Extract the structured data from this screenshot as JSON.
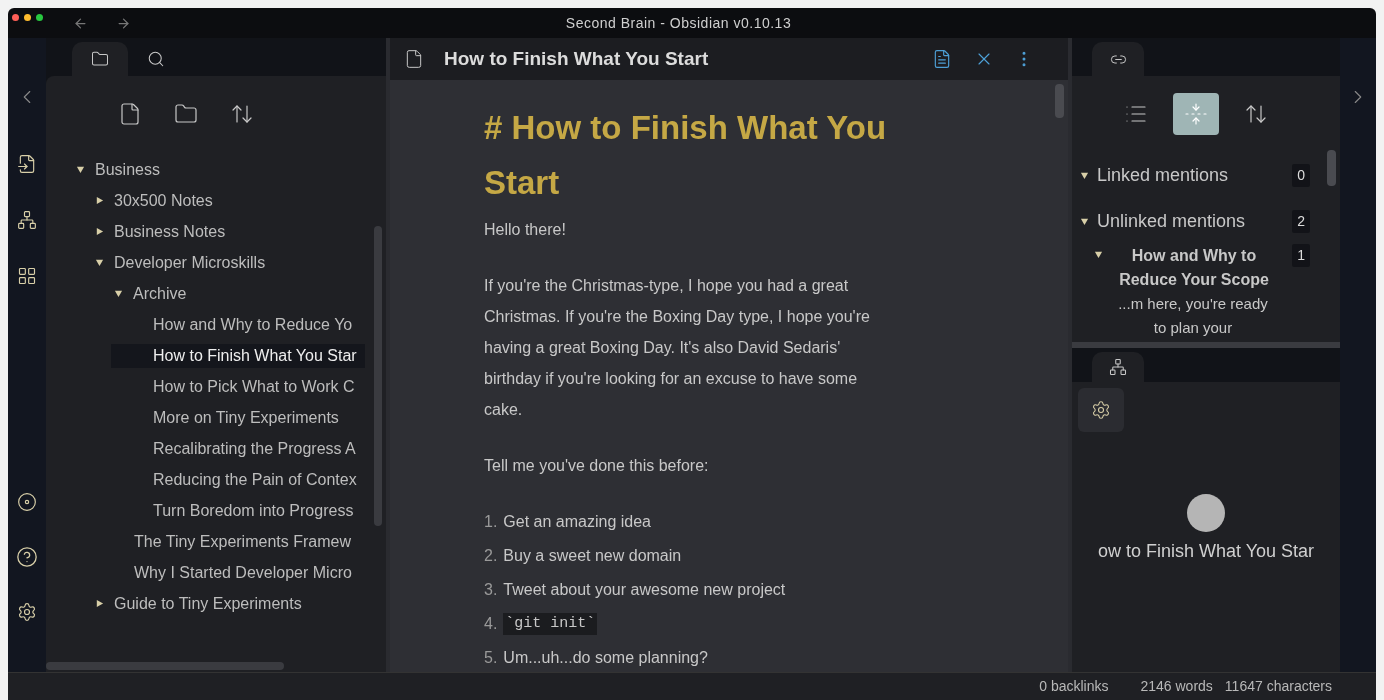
{
  "window": {
    "title": "Second Brain - Obsidian v0.10.13"
  },
  "left_panel": {
    "tabs": [
      {
        "selected": true
      },
      {
        "selected": false
      }
    ],
    "tree": [
      {
        "kind": "folder",
        "label": "Business",
        "expanded": true,
        "selected": false,
        "children": [
          {
            "kind": "folder",
            "label": "30x500 Notes",
            "expanded": false,
            "selected": false
          },
          {
            "kind": "folder",
            "label": "Business Notes",
            "expanded": false,
            "selected": false
          },
          {
            "kind": "folder",
            "label": "Developer Microskills",
            "expanded": true,
            "selected": false,
            "children": [
              {
                "kind": "folder",
                "label": "Archive",
                "expanded": true,
                "selected": false,
                "children": [
                  {
                    "kind": "file",
                    "label": "How and Why to Reduce Yo",
                    "selected": false
                  },
                  {
                    "kind": "file",
                    "label": "How to Finish What You Star",
                    "selected": true
                  },
                  {
                    "kind": "file",
                    "label": "How to Pick What to Work C",
                    "selected": false
                  },
                  {
                    "kind": "file",
                    "label": "More on Tiny Experiments",
                    "selected": false
                  },
                  {
                    "kind": "file",
                    "label": "Recalibrating the Progress A",
                    "selected": false
                  },
                  {
                    "kind": "file",
                    "label": "Reducing the Pain of Contex",
                    "selected": false
                  },
                  {
                    "kind": "file",
                    "label": "Turn Boredom into Progress",
                    "selected": false
                  }
                ]
              },
              {
                "kind": "file",
                "label": "The Tiny Experiments Framew",
                "selected": false
              },
              {
                "kind": "file",
                "label": "Why I Started Developer Micro",
                "selected": false
              }
            ]
          },
          {
            "kind": "folder",
            "label": "Guide to Tiny Experiments",
            "expanded": false,
            "selected": false
          }
        ]
      }
    ]
  },
  "editor": {
    "tab_title": "How to Finish What You Start",
    "heading": "# How to Finish What You Start",
    "paragraphs": [
      "Hello there!",
      "If you're the Christmas-type, I hope you had a great Christmas. If you're the Boxing Day type, I hope you're having a great Boxing Day. It's also David Sedaris' birthday if you're looking for an excuse to have some cake.",
      "Tell me you've done this before:"
    ],
    "list": [
      {
        "number": "1.",
        "text": "Get an amazing idea",
        "kind": "text"
      },
      {
        "number": "2.",
        "text": "Buy a sweet new domain",
        "kind": "text"
      },
      {
        "number": "3.",
        "text": "Tweet about your awesome new project",
        "kind": "text"
      },
      {
        "number": "4.",
        "text": "`git init`",
        "kind": "code"
      },
      {
        "number": "5.",
        "text": "Um...uh...do some planning?",
        "kind": "text"
      }
    ]
  },
  "backlinks": {
    "toolbar": [
      {
        "selected": false
      },
      {
        "selected": true
      },
      {
        "selected": false
      }
    ],
    "sections": [
      {
        "label": "Linked mentions",
        "count": "0",
        "expanded": true
      },
      {
        "label": "Unlinked mentions",
        "count": "2",
        "expanded": true,
        "children": [
          {
            "label": "How and Why to Reduce Your Scope",
            "count": "1",
            "expanded": true,
            "snippet": "...m here, you're ready to plan your"
          }
        ]
      }
    ]
  },
  "graph": {
    "node_label": "ow to Finish What You Star"
  },
  "status_bar": {
    "backlinks": "0 backlinks",
    "words": "2146 words",
    "characters": "11647 characters"
  }
}
